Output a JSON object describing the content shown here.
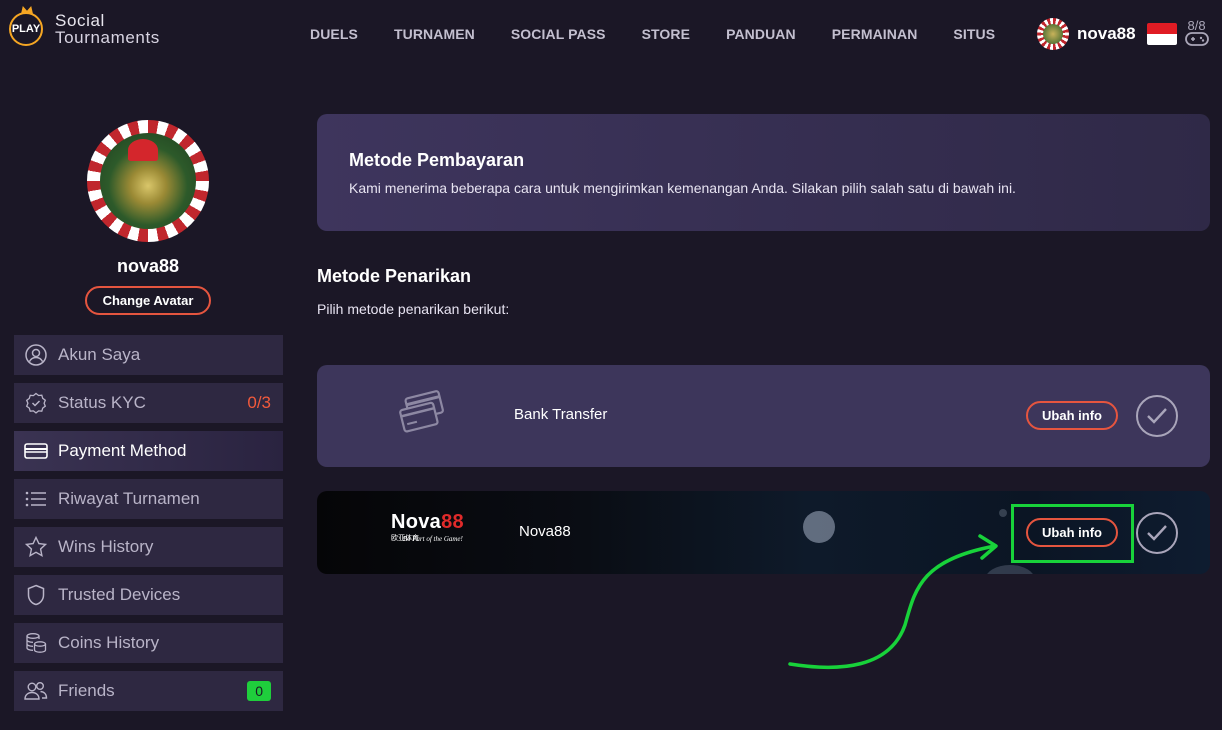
{
  "brand": {
    "logo_badge": "PLAY",
    "line1": "Social",
    "line2": "Tournaments"
  },
  "nav": [
    "DUELS",
    "TURNAMEN",
    "SOCIAL PASS",
    "STORE",
    "PANDUAN",
    "PERMAINAN",
    "SITUS"
  ],
  "user": {
    "name": "nova88",
    "gamepad_label": "8/8"
  },
  "profile": {
    "name": "nova88",
    "change_avatar": "Change Avatar"
  },
  "sidebar": {
    "items": [
      {
        "label": "Akun Saya",
        "icon": "user-circle-icon"
      },
      {
        "label": "Status KYC",
        "icon": "shield-check-icon",
        "count": "0/3"
      },
      {
        "label": "Payment Method",
        "icon": "credit-card-icon"
      },
      {
        "label": "Riwayat Turnamen",
        "icon": "list-icon"
      },
      {
        "label": "Wins History",
        "icon": "star-icon"
      },
      {
        "label": "Trusted Devices",
        "icon": "shield-icon"
      },
      {
        "label": "Coins History",
        "icon": "coins-icon"
      },
      {
        "label": "Friends",
        "icon": "users-icon",
        "badge": "0"
      }
    ]
  },
  "info": {
    "title": "Metode Pembayaran",
    "description": "Kami menerima beberapa cara untuk mengirimkan kemenangan Anda. Silakan pilih salah satu di bawah ini."
  },
  "withdrawal": {
    "title": "Metode Penarikan",
    "subtitle": "Pilih metode penarikan berikut:",
    "methods": [
      {
        "name": "Bank Transfer",
        "button": "Ubah info"
      },
      {
        "name": "Nova88",
        "button": "Ubah info",
        "logo_brand_a": "Nova",
        "logo_brand_b": "88",
        "logo_cn": "欧亚体育",
        "logo_tag": "Be Part of the Game!"
      }
    ]
  },
  "colors": {
    "accent": "#e5553f",
    "highlight": "#18d23a",
    "background": "#1b1726",
    "card": "#3d365b"
  }
}
